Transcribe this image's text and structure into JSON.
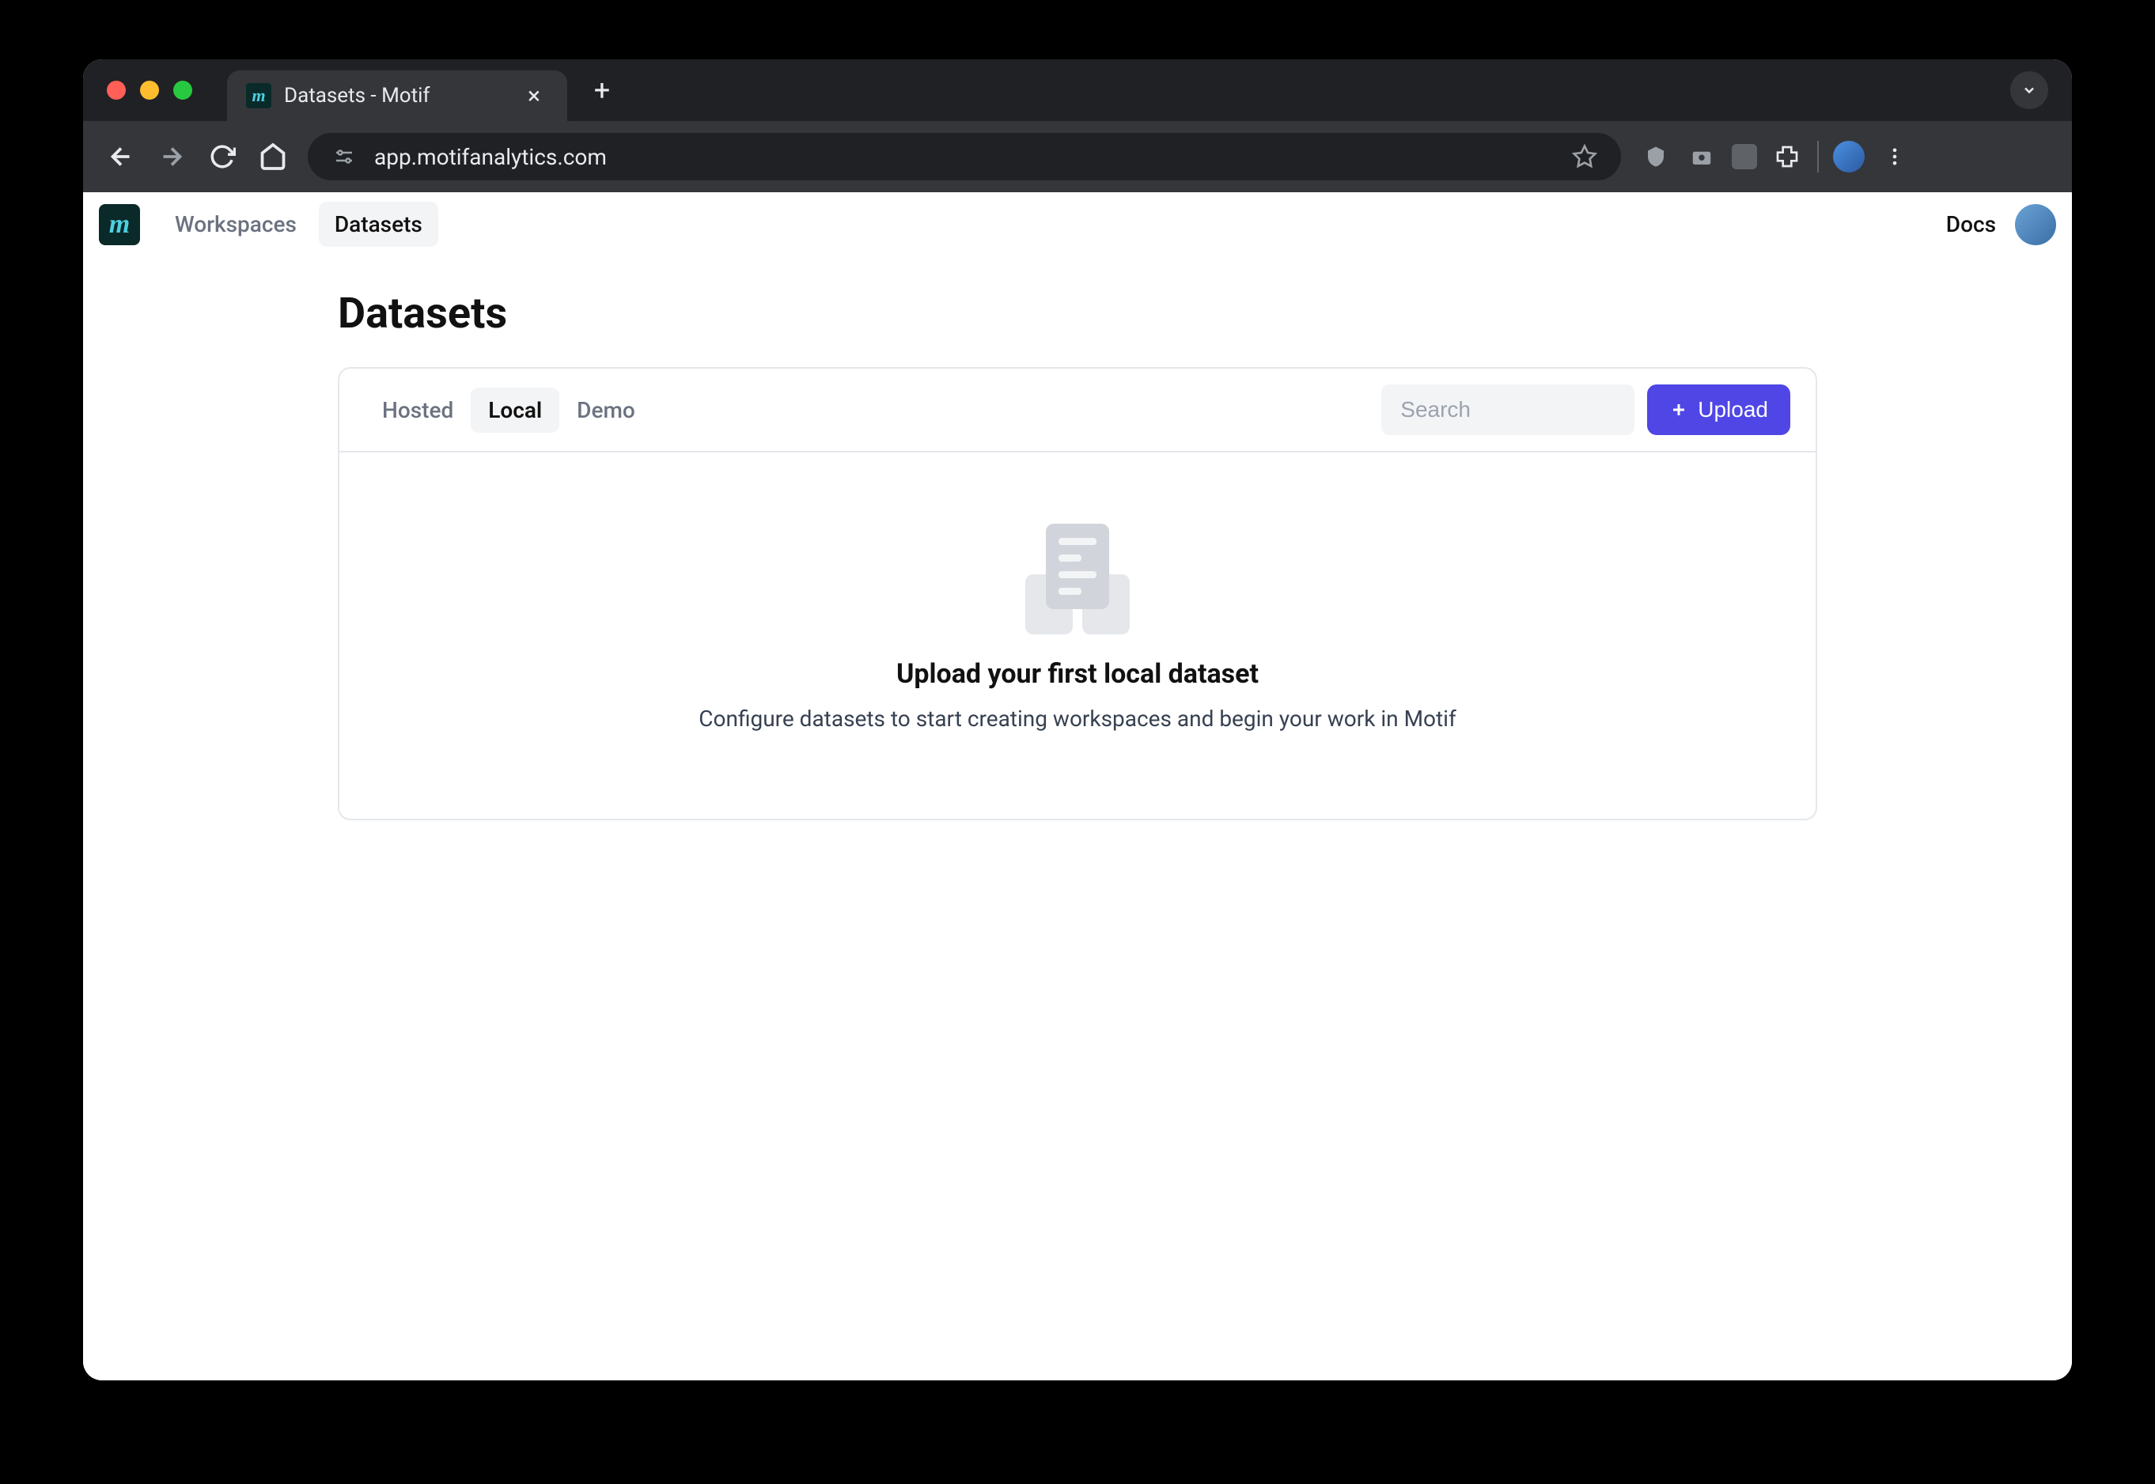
{
  "browser": {
    "tab_title": "Datasets - Motif",
    "url": "app.motifanalytics.com"
  },
  "app_header": {
    "nav": {
      "workspaces": "Workspaces",
      "datasets": "Datasets"
    },
    "docs": "Docs"
  },
  "page": {
    "title": "Datasets",
    "tabs": {
      "hosted": "Hosted",
      "local": "Local",
      "demo": "Demo"
    },
    "search_placeholder": "Search",
    "upload_label": "Upload",
    "empty": {
      "title": "Upload your first local dataset",
      "desc": "Configure datasets to start creating workspaces and begin your work in Motif"
    }
  }
}
